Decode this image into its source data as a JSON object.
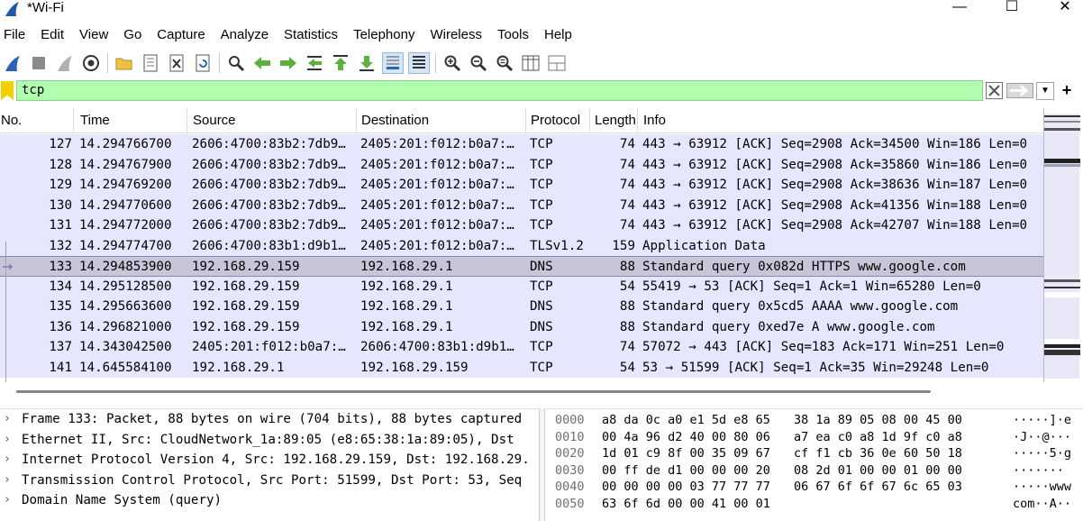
{
  "window": {
    "title": "*Wi-Fi",
    "controls": {
      "minimize": "—",
      "maximize": "☐",
      "close": "✕"
    }
  },
  "menu": [
    "File",
    "Edit",
    "View",
    "Go",
    "Capture",
    "Analyze",
    "Statistics",
    "Telephony",
    "Wireless",
    "Tools",
    "Help"
  ],
  "filter": {
    "value": "tcp"
  },
  "columns": [
    "No.",
    "Time",
    "Source",
    "Destination",
    "Protocol",
    "Length",
    "Info"
  ],
  "packets": [
    {
      "no": "127",
      "time": "14.294766700",
      "src": "2606:4700:83b2:7db9…",
      "dst": "2405:201:f012:b0a7:…",
      "proto": "TCP",
      "len": "74",
      "info": "443 → 63912 [ACK] Seq=2908 Ack=34500 Win=186 Len=0"
    },
    {
      "no": "128",
      "time": "14.294767900",
      "src": "2606:4700:83b2:7db9…",
      "dst": "2405:201:f012:b0a7:…",
      "proto": "TCP",
      "len": "74",
      "info": "443 → 63912 [ACK] Seq=2908 Ack=35860 Win=186 Len=0"
    },
    {
      "no": "129",
      "time": "14.294769200",
      "src": "2606:4700:83b2:7db9…",
      "dst": "2405:201:f012:b0a7:…",
      "proto": "TCP",
      "len": "74",
      "info": "443 → 63912 [ACK] Seq=2908 Ack=38636 Win=187 Len=0"
    },
    {
      "no": "130",
      "time": "14.294770600",
      "src": "2606:4700:83b2:7db9…",
      "dst": "2405:201:f012:b0a7:…",
      "proto": "TCP",
      "len": "74",
      "info": "443 → 63912 [ACK] Seq=2908 Ack=41356 Win=188 Len=0"
    },
    {
      "no": "131",
      "time": "14.294772000",
      "src": "2606:4700:83b2:7db9…",
      "dst": "2405:201:f012:b0a7:…",
      "proto": "TCP",
      "len": "74",
      "info": "443 → 63912 [ACK] Seq=2908 Ack=42707 Win=188 Len=0"
    },
    {
      "no": "132",
      "time": "14.294774700",
      "src": "2606:4700:83b1:d9b1…",
      "dst": "2405:201:f012:b0a7:…",
      "proto": "TLSv1.2",
      "len": "159",
      "info": "Application Data"
    },
    {
      "no": "133",
      "time": "14.294853900",
      "src": "192.168.29.159",
      "dst": "192.168.29.1",
      "proto": "DNS",
      "len": "88",
      "info": "Standard query 0x082d HTTPS www.google.com"
    },
    {
      "no": "134",
      "time": "14.295128500",
      "src": "192.168.29.159",
      "dst": "192.168.29.1",
      "proto": "TCP",
      "len": "54",
      "info": "55419 → 53 [ACK] Seq=1 Ack=1 Win=65280 Len=0"
    },
    {
      "no": "135",
      "time": "14.295663600",
      "src": "192.168.29.159",
      "dst": "192.168.29.1",
      "proto": "DNS",
      "len": "88",
      "info": "Standard query 0x5cd5 AAAA www.google.com"
    },
    {
      "no": "136",
      "time": "14.296821000",
      "src": "192.168.29.159",
      "dst": "192.168.29.1",
      "proto": "DNS",
      "len": "88",
      "info": "Standard query 0xed7e A www.google.com"
    },
    {
      "no": "137",
      "time": "14.343042500",
      "src": "2405:201:f012:b0a7:…",
      "dst": "2606:4700:83b1:d9b1…",
      "proto": "TCP",
      "len": "74",
      "info": "57072 → 443 [ACK] Seq=183 Ack=171 Win=251 Len=0"
    },
    {
      "no": "141",
      "time": "14.645584100",
      "src": "192.168.29.1",
      "dst": "192.168.29.159",
      "proto": "TCP",
      "len": "54",
      "info": "53 → 51599 [ACK] Seq=1 Ack=35 Win=29248 Len=0"
    }
  ],
  "selected_packet": "133",
  "details": [
    "Frame 133: Packet, 88 bytes on wire (704 bits), 88 bytes captured",
    "Ethernet II, Src: CloudNetwork_1a:89:05 (e8:65:38:1a:89:05), Dst",
    "Internet Protocol Version 4, Src: 192.168.29.159, Dst: 192.168.29.",
    "Transmission Control Protocol, Src Port: 51599, Dst Port: 53, Seq",
    "Domain Name System (query)"
  ],
  "hex": [
    {
      "off": "0000",
      "b1": "a8 da 0c a0 e1 5d e8 65",
      "b2": "38 1a 89 05 08 00 45 00",
      "ascii": "·····]·e"
    },
    {
      "off": "0010",
      "b1": "00 4a 96 d2 40 00 80 06",
      "b2": "a7 ea c0 a8 1d 9f c0 a8",
      "ascii": "·J··@···"
    },
    {
      "off": "0020",
      "b1": "1d 01 c9 8f 00 35 09 67",
      "b2": "cf f1 cb 36 0e 60 50 18",
      "ascii": "·····5·g"
    },
    {
      "off": "0030",
      "b1": "00 ff de d1 00 00 00 20",
      "b2": "08 2d 01 00 00 01 00 00",
      "ascii": "······· "
    },
    {
      "off": "0040",
      "b1": "00 00 00 00 03 77 77 77",
      "b2": "06 67 6f 6f 67 6c 65 03",
      "ascii": "·····www"
    },
    {
      "off": "0050",
      "b1": "63 6f 6d 00 00 41 00 01",
      "b2": "",
      "ascii": "com··A··"
    }
  ],
  "colors": {
    "row_bg": "#e7e6ff",
    "selected_bg": "#c6c6d8",
    "filter_bg": "#afffaf",
    "flag": "#f5d000"
  }
}
